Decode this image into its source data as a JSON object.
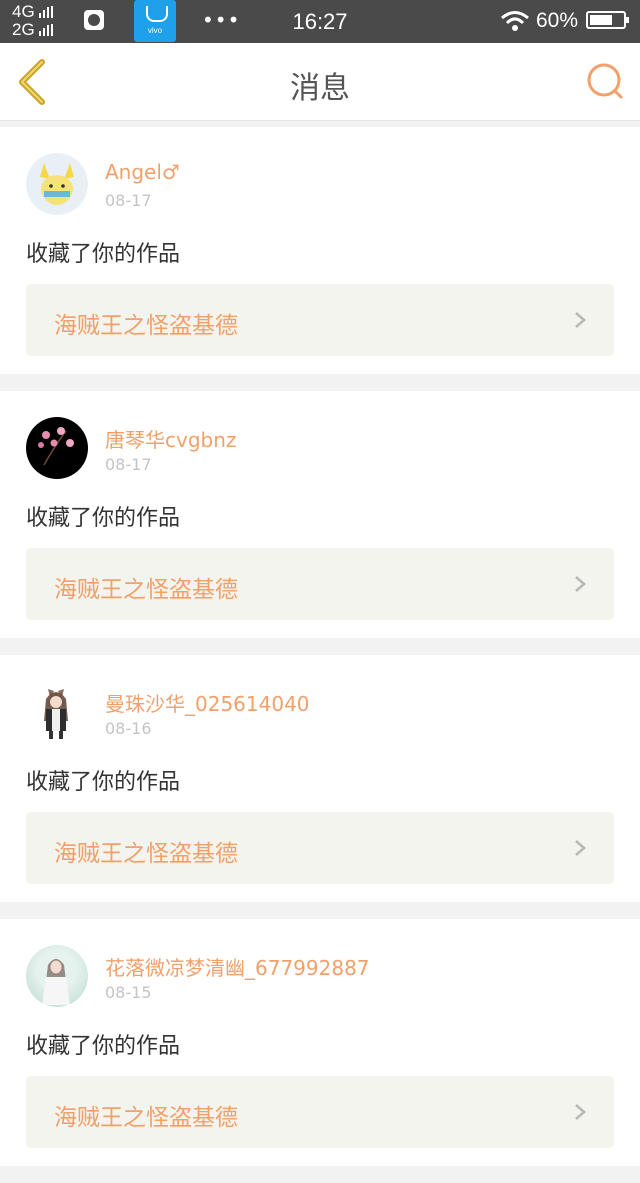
{
  "status_bar": {
    "network_top": "4G",
    "network_bottom": "2G",
    "app_badge": "vivo",
    "time": "16:27",
    "battery_percent": "60%",
    "battery_level": 0.6
  },
  "nav": {
    "title": "消息",
    "back_icon": "chevron-left-icon",
    "search_icon": "search-icon",
    "accent_color": "#f2a06a"
  },
  "messages": [
    {
      "user": "Angel♂",
      "date": "08-17",
      "action": "收藏了你的作品",
      "work": "海贼王之怪盗基德"
    },
    {
      "user": "唐琴华cvgbnz",
      "date": "08-17",
      "action": "收藏了你的作品",
      "work": "海贼王之怪盗基德"
    },
    {
      "user": "曼珠沙华_025614040",
      "date": "08-16",
      "action": "收藏了你的作品",
      "work": "海贼王之怪盗基德"
    },
    {
      "user": "花落微凉梦清幽_677992887",
      "date": "08-15",
      "action": "收藏了你的作品",
      "work": "海贼王之怪盗基德"
    }
  ]
}
